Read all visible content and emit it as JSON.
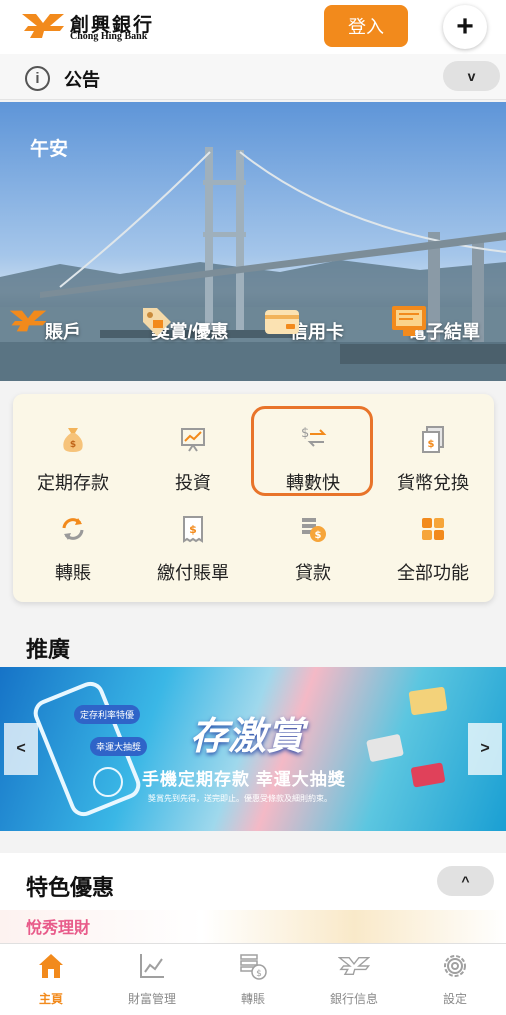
{
  "header": {
    "bank_name_cn": "創興銀行",
    "bank_name_en": "Chong Hing Bank",
    "login_label": "登入",
    "plus_label": "+"
  },
  "notice": {
    "info_symbol": "i",
    "title": "公告",
    "toggle_symbol": "v"
  },
  "hero": {
    "greeting": "午安",
    "items": [
      {
        "label": "賬戶",
        "icon": "bank-logo-icon"
      },
      {
        "label": "獎賞/優惠",
        "icon": "gift-tag-icon"
      },
      {
        "label": "信用卡",
        "icon": "credit-card-icon"
      },
      {
        "label": "電子結單",
        "icon": "e-statement-icon"
      }
    ]
  },
  "quick_actions": {
    "items": [
      {
        "label": "定期存款",
        "icon": "money-bag-icon"
      },
      {
        "label": "投資",
        "icon": "investment-chart-icon"
      },
      {
        "label": "轉數快",
        "icon": "fps-transfer-icon"
      },
      {
        "label": "貨幣兌換",
        "icon": "currency-exchange-icon"
      },
      {
        "label": "轉賬",
        "icon": "transfer-cycle-icon"
      },
      {
        "label": "繳付賬單",
        "icon": "bill-payment-icon"
      },
      {
        "label": "貸款",
        "icon": "loan-coins-icon"
      },
      {
        "label": "全部功能",
        "icon": "all-functions-grid-icon"
      }
    ],
    "highlight_color": "#e8742a"
  },
  "promotion": {
    "title": "推廣",
    "prev_symbol": "<",
    "next_symbol": ">",
    "banner_title": "存激賞",
    "banner_subtitle": "手機定期存款 幸運大抽獎",
    "banner_note": "獎賞先到先得，送完即止。優惠受條款及細則約束。",
    "pill_1": "定存利率特優",
    "pill_2": "幸運大抽獎"
  },
  "features": {
    "title": "特色優惠",
    "toggle_symbol": "^",
    "strip_tag": "悅秀理財"
  },
  "tabbar": {
    "items": [
      {
        "label": "主頁",
        "icon": "home-icon",
        "active": true
      },
      {
        "label": "財富管理",
        "icon": "wealth-chart-icon",
        "active": false
      },
      {
        "label": "轉賬",
        "icon": "transfer-coins-icon",
        "active": false
      },
      {
        "label": "銀行信息",
        "icon": "bank-info-icon",
        "active": false
      },
      {
        "label": "設定",
        "icon": "settings-gear-icon",
        "active": false
      }
    ]
  },
  "colors": {
    "brand_orange": "#f28a1c",
    "active_tab": "#f28a1c",
    "inactive_tab": "#8a8a8a"
  }
}
